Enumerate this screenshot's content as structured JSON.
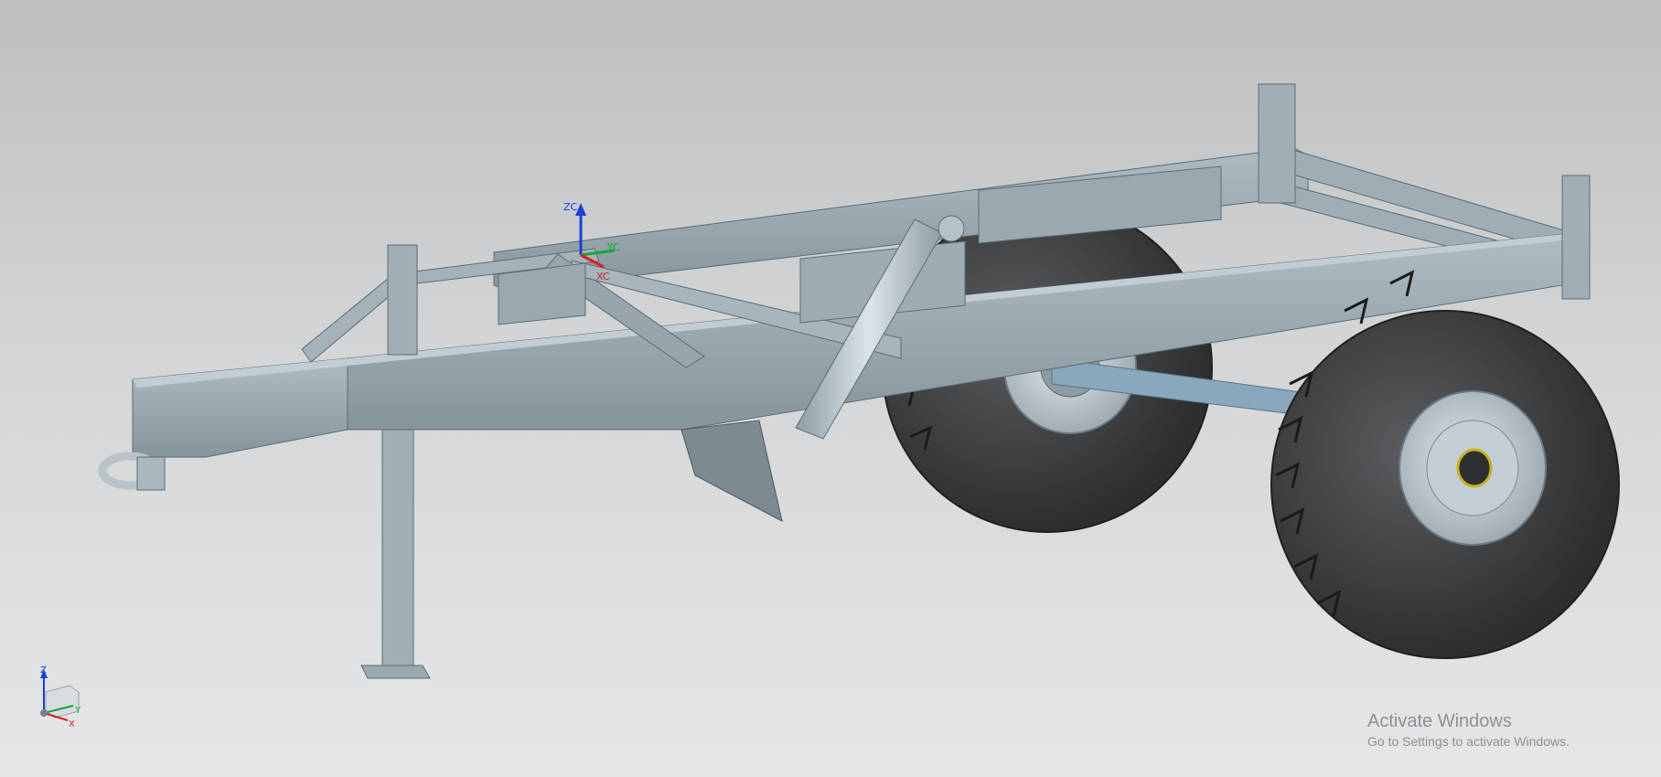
{
  "wcs": {
    "z_label": "ZC",
    "y_label": "YC",
    "x_label": "XC"
  },
  "view_triad": {
    "z_label": "Z",
    "y_label": "Y",
    "x_label": "X"
  },
  "watermark": {
    "title": "Activate Windows",
    "subtitle": "Go to Settings to activate Windows."
  },
  "colors": {
    "frame": "#8f9ea6",
    "frame_light": "#a9b7be",
    "frame_dark": "#6c7b83",
    "tire": "#3c3d3f",
    "rim": "#b5c0c6",
    "wcs_z": "#1a3fd6",
    "wcs_y": "#19a43a",
    "wcs_x": "#d62020"
  },
  "icons": [
    "wcs-axes-icon",
    "view-triad-icon"
  ]
}
